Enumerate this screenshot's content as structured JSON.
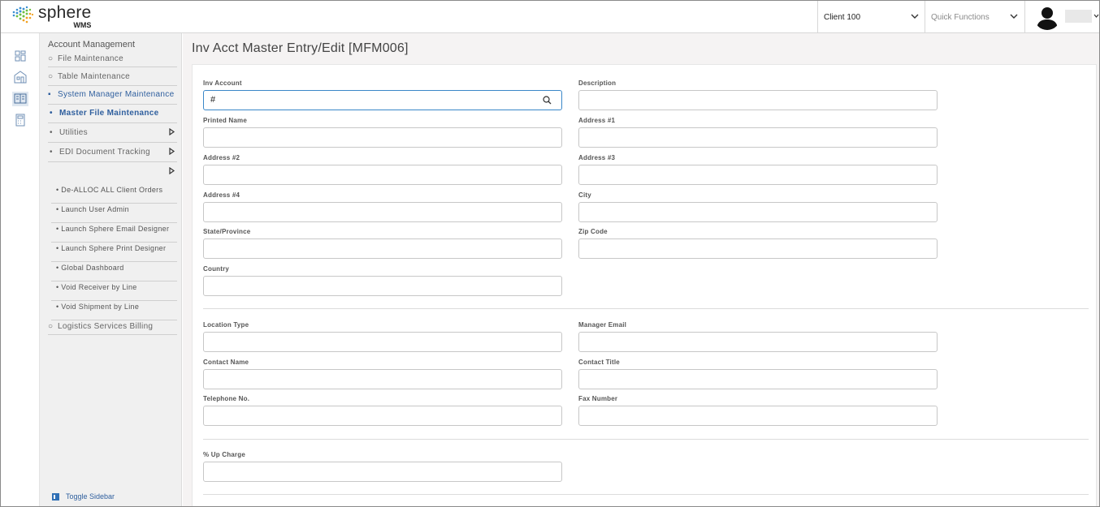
{
  "header": {
    "logo_name": "sphere",
    "logo_sub": "WMS",
    "client_select": "Client 100",
    "quick_functions": "Quick Functions"
  },
  "rail": {
    "icons": [
      "dashboard-icon",
      "warehouse-icon",
      "ledger-icon",
      "calculator-icon"
    ]
  },
  "sidebar": {
    "title": "Account Management",
    "items": [
      {
        "label": "File Maintenance"
      },
      {
        "label": "Table Maintenance"
      },
      {
        "label": "System Manager Maintenance"
      },
      {
        "label": "Master File Maintenance"
      },
      {
        "label": "Utilities"
      },
      {
        "label": "EDI Document Tracking"
      },
      {
        "label": ""
      }
    ],
    "subitems": [
      "De-ALLOC ALL Client Orders",
      "Launch User Admin",
      "Launch Sphere Email Designer",
      "Launch Sphere Print Designer",
      "Global Dashboard",
      "Void Receiver by Line",
      "Void Shipment by Line"
    ],
    "last_item": "Logistics Services Billing",
    "toggle": "Toggle Sidebar"
  },
  "page": {
    "title": "Inv Acct Master Entry/Edit [MFM006]"
  },
  "form": {
    "inv_account": {
      "label": "Inv Account",
      "value": "#"
    },
    "description": {
      "label": "Description",
      "value": ""
    },
    "printed_name": {
      "label": "Printed Name",
      "value": ""
    },
    "address1": {
      "label": "Address #1",
      "value": ""
    },
    "address2": {
      "label": "Address #2",
      "value": ""
    },
    "address3": {
      "label": "Address #3",
      "value": ""
    },
    "address4": {
      "label": "Address #4",
      "value": ""
    },
    "city": {
      "label": "City",
      "value": ""
    },
    "state": {
      "label": "State/Province",
      "value": ""
    },
    "zip": {
      "label": "Zip Code",
      "value": ""
    },
    "country": {
      "label": "Country",
      "value": ""
    },
    "location_type": {
      "label": "Location Type",
      "value": ""
    },
    "manager_email": {
      "label": "Manager Email",
      "value": ""
    },
    "contact_name": {
      "label": "Contact Name",
      "value": ""
    },
    "contact_title": {
      "label": "Contact Title",
      "value": ""
    },
    "telephone": {
      "label": "Telephone No.",
      "value": ""
    },
    "fax": {
      "label": "Fax Number",
      "value": ""
    },
    "up_charge": {
      "label": "% Up Charge",
      "value": ""
    }
  },
  "colors": {
    "accent": "#2f5f9e",
    "focus_border": "#3a87c8",
    "sidebar_bg": "#f0f0f0"
  }
}
